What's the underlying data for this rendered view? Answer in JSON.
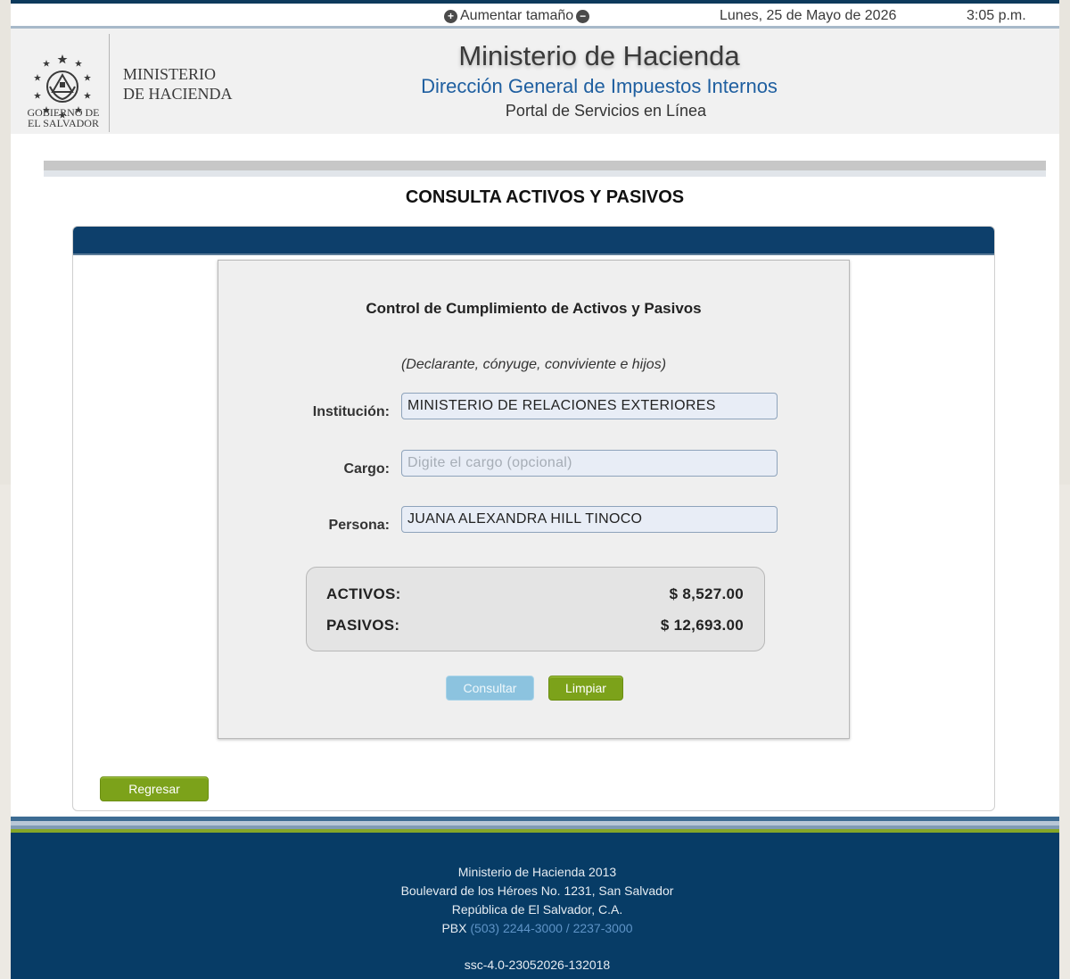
{
  "topbar": {
    "increase_label": "Aumentar tamaño",
    "date": "Lunes, 25 de Mayo de 2026",
    "time": "3:05 p.m."
  },
  "header": {
    "logo_text_1": "MINISTERIO",
    "logo_text_2": "DE HACIENDA",
    "gob_1": "GOBIERNO DE",
    "gob_2": "EL SALVADOR",
    "title": "Ministerio de Hacienda",
    "subtitle": "Dirección General de Impuestos Internos",
    "portal": "Portal de Servicios en Línea"
  },
  "page_title": "CONSULTA ACTIVOS Y PASIVOS",
  "form": {
    "title": "Control de Cumplimiento de Activos y Pasivos",
    "note": "(Declarante, cónyuge, conviviente e hijos)",
    "institucion_label": "Institución:",
    "institucion_value": "MINISTERIO DE RELACIONES EXTERIORES",
    "cargo_label": "Cargo:",
    "cargo_placeholder": "Digite el cargo (opcional)",
    "persona_label": "Persona:",
    "persona_value": "JUANA ALEXANDRA HILL TINOCO"
  },
  "summary": {
    "activos_label": "ACTIVOS:",
    "activos_value": "$ 8,527.00",
    "pasivos_label": "PASIVOS:",
    "pasivos_value": "$ 12,693.00"
  },
  "buttons": {
    "consultar": "Consultar",
    "limpiar": "Limpiar",
    "regresar": "Regresar"
  },
  "footer": {
    "line1": "Ministerio de Hacienda 2013",
    "line2": "Boulevard de los Héroes No. 1231, San Salvador",
    "line3": "República de El Salvador, C.A.",
    "pbx_label": "PBX",
    "pbx_numbers": "(503) 2244-3000 / 2237-3000",
    "version": "ssc-4.0-23052026-132018"
  },
  "colors": {
    "navy": "#0d3f6b",
    "accent_green": "#7ca21a",
    "link_blue": "#1f5fa0"
  }
}
